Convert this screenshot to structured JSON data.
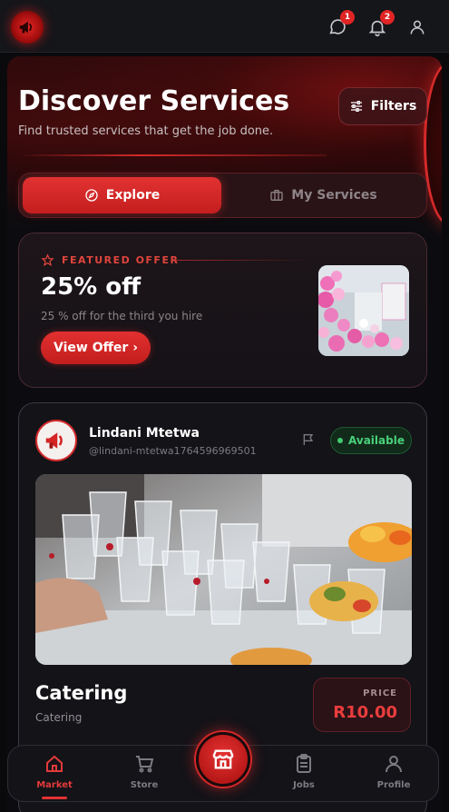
{
  "header": {
    "logo": "megaphone-logo",
    "messages_badge": "1",
    "notifications_badge": "2"
  },
  "hero": {
    "title": "Discover Services",
    "subtitle": "Find trusted services that get the job done.",
    "filters_label": "Filters"
  },
  "tabs": [
    {
      "label": "Explore",
      "active": true
    },
    {
      "label": "My Services",
      "active": false
    }
  ],
  "featured": {
    "label": "FEATURED OFFER",
    "title": "25% off",
    "description": "25 % off for the third you hire",
    "button": "View Offer ›"
  },
  "service": {
    "provider_name": "Lindani Mtetwa",
    "provider_handle": "@lindani-mtetwa1764596969501",
    "status": "Available",
    "title": "Catering",
    "category": "Catering",
    "price_label": "PRICE",
    "price": "R10.00"
  },
  "nav": {
    "items": [
      {
        "label": "Market",
        "active": true
      },
      {
        "label": "Store",
        "active": false
      },
      {
        "label": "Jobs",
        "active": false
      },
      {
        "label": "Profile",
        "active": false
      }
    ]
  },
  "colors": {
    "accent": "#e23232",
    "background": "#0a0a0d",
    "available": "#49d07a"
  }
}
